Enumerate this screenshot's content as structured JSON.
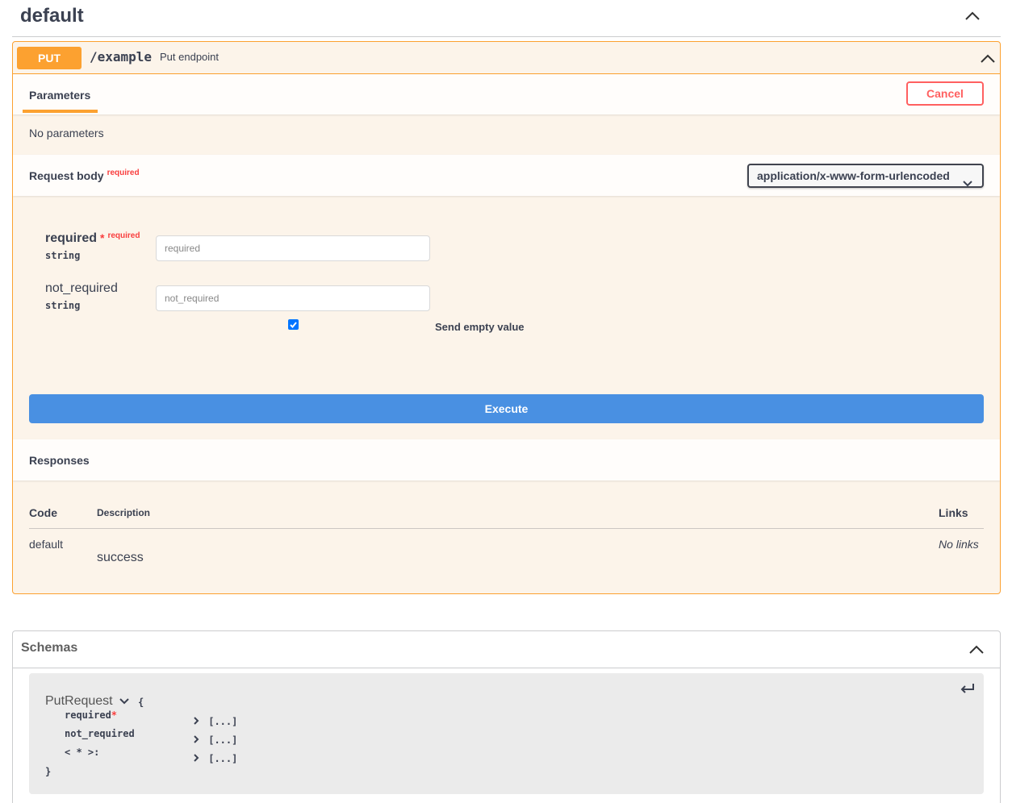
{
  "tag": {
    "title": "default"
  },
  "operation": {
    "method": "PUT",
    "path": "/example",
    "summary": "Put endpoint",
    "parameters_tab": "Parameters",
    "cancel_label": "Cancel",
    "no_parameters": "No parameters",
    "request_body": {
      "title": "Request body",
      "required_label": "required",
      "content_type": "application/x-www-form-urlencoded",
      "fields": [
        {
          "name": "required",
          "required_marker": "*",
          "required_label": "required",
          "type": "string",
          "placeholder": "required"
        },
        {
          "name": "not_required",
          "type": "string",
          "placeholder": "not_required"
        }
      ],
      "send_empty_label": "Send empty value",
      "send_empty_checked": true
    },
    "execute_label": "Execute",
    "responses": {
      "title": "Responses",
      "headers": {
        "code": "Code",
        "description": "Description",
        "links": "Links"
      },
      "rows": [
        {
          "code": "default",
          "description": "success",
          "links": "No links"
        }
      ]
    }
  },
  "schemas": {
    "title": "Schemas",
    "model": {
      "name": "PutRequest",
      "open_brace": "{",
      "close_brace": "}",
      "properties": [
        {
          "name": "required",
          "required_marker": "*",
          "value": "[...]"
        },
        {
          "name": "not_required",
          "value": "[...]"
        },
        {
          "name": "< * >:",
          "value": "[...]"
        }
      ]
    }
  },
  "colors": {
    "put": "#fca130",
    "execute": "#4990e2",
    "cancel": "#ff6060",
    "required": "#f93e3e"
  }
}
